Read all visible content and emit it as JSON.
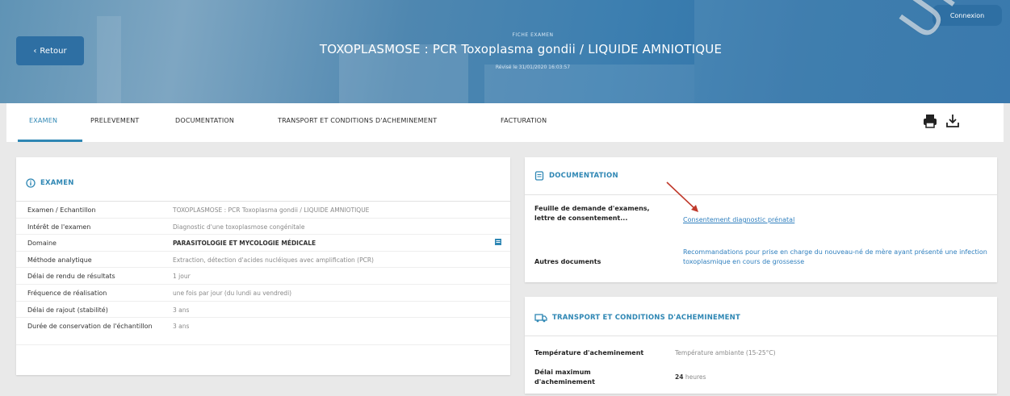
{
  "header": {
    "back_label": "Retour",
    "login_label": "Connexion",
    "overline": "FICHE EXAMEN",
    "title": "TOXOPLASMOSE : PCR Toxoplasma gondii / LIQUIDE AMNIOTIQUE",
    "subline": "Révisé le 31/01/2020 16:03:57"
  },
  "tabs": [
    {
      "label": "EXAMEN",
      "active": true
    },
    {
      "label": "PRELEVEMENT"
    },
    {
      "label": "DOCUMENTATION"
    },
    {
      "label": "TRANSPORT ET CONDITIONS D'ACHEMINEMENT"
    },
    {
      "label": "FACTURATION"
    }
  ],
  "toolbar_icons": [
    "print-icon",
    "download-icon"
  ],
  "exam": {
    "title": "EXAMEN",
    "rows": [
      {
        "label": "Examen / Echantillon",
        "value": "TOXOPLASMOSE : PCR Toxoplasma gondii / LIQUIDE AMNIOTIQUE"
      },
      {
        "label": "Intérêt de l'examen",
        "value": "Diagnostic d'une toxoplasmose congénitale"
      },
      {
        "label": "Domaine",
        "value": "PARASITOLOGIE ET MYCOLOGIE MÉDICALE"
      },
      {
        "label": "Méthode analytique",
        "value": "Extraction, détection d'acides nucléiques avec amplification (PCR)"
      },
      {
        "label": "Délai de rendu de résultats",
        "value": "1 jour"
      },
      {
        "label": "Fréquence de réalisation",
        "value": "une fois par jour (du lundi au vendredi)"
      },
      {
        "label": "Délai de rajout (stabilité)",
        "value": "3 ans"
      },
      {
        "label": "Durée de conservation de l'échantillon",
        "value": "3 ans"
      }
    ]
  },
  "documentation": {
    "title": "DOCUMENTATION",
    "row1_label": "Feuille de demande d'examens, lettre de consentement...",
    "row1_link": "Consentement diagnostic prénatal",
    "row2_label": "Autres documents",
    "row2_link": "Recommandations pour prise en charge du nouveau-né de mère ayant présenté une infection toxoplasmique en cours de grossesse"
  },
  "transport": {
    "title": "TRANSPORT ET CONDITIONS D'ACHEMINEMENT",
    "temp_label": "Température d'acheminement",
    "temp_value": "Température ambiante (15-25°C)",
    "delay_label": "Délai maximum d'acheminement",
    "delay_number": "24",
    "delay_unit": "heures"
  },
  "stamp_text": "UNIQUE FAIT",
  "colors": {
    "accent": "#2f87b4",
    "link": "#2f7fbe",
    "button": "#2e6fa3",
    "arrow": "#c0392b"
  }
}
